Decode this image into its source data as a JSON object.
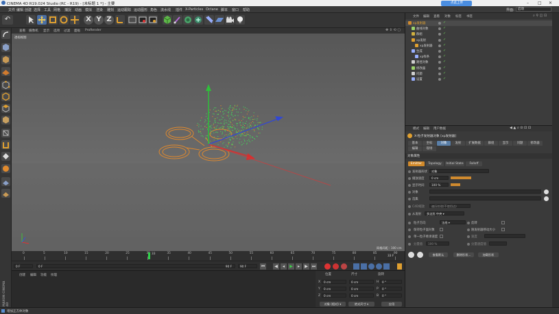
{
  "window": {
    "title": "CINEMA 4D R19.024 Studio (RC - R19) - [未标题 1 *] - 主要",
    "upload_button": "点此上传"
  },
  "menu": [
    "文件",
    "编辑",
    "创建",
    "选择",
    "工具",
    "网格",
    "捕捉",
    "动画",
    "模拟",
    "渲染",
    "雕刻",
    "运动跟踪",
    "运动图形",
    "角色",
    "流水线",
    "插件",
    "X-Particles",
    "Octane",
    "脚本",
    "窗口",
    "帮助"
  ],
  "layout": {
    "label": "界面:",
    "value": "启动"
  },
  "viewport": {
    "menu": [
      "查看",
      "摄像机",
      "显示",
      "选项",
      "过滤",
      "面板",
      "ProRender"
    ],
    "label": "透视视图",
    "grid_spacing": "网格间距 : 100 cm"
  },
  "timeline": {
    "ticks": [
      "0",
      "5",
      "10",
      "15",
      "20",
      "25",
      "30",
      "35",
      "40",
      "45",
      "50",
      "55",
      "60",
      "65",
      "70",
      "75",
      "80",
      "85",
      "90"
    ],
    "current_frame": "33 F",
    "playhead_label": "33",
    "end_label": "90 F",
    "start_field": "0 F",
    "range_start": "0 F",
    "range_end": "90 F",
    "range_end2": "90 F"
  },
  "material_manager": {
    "tabs": [
      "创建",
      "编辑",
      "功能",
      "纹理"
    ]
  },
  "coordinates": {
    "headers": [
      "位置",
      "尺寸",
      "旋转"
    ],
    "rows": [
      {
        "axis": "X",
        "pos": "0 cm",
        "size": "0 cm",
        "rot_label": "H",
        "rot": "0 °"
      },
      {
        "axis": "Y",
        "pos": "0 cm",
        "size": "0 cm",
        "rot_label": "P",
        "rot": "0 °"
      },
      {
        "axis": "Z",
        "pos": "0 cm",
        "size": "0 cm",
        "rot_label": "B",
        "rot": "0 °"
      }
    ],
    "mode1": "对象 (相对)",
    "mode2": "绝对尺寸",
    "apply": "应用"
  },
  "object_manager": {
    "menu": [
      "文件",
      "编辑",
      "查看",
      "对象",
      "标签",
      "书签"
    ],
    "items": [
      {
        "name": "xp发射器",
        "indent": 0,
        "color": "#d08a2e"
      },
      {
        "name": "曲线对象",
        "indent": 1,
        "color": "#9bd36a"
      },
      {
        "name": "群组",
        "indent": 1,
        "color": "#d0b040"
      },
      {
        "name": "xp发射",
        "indent": 1,
        "color": "#e0a030"
      },
      {
        "name": "xp发射器",
        "indent": 2,
        "color": "#e0a030"
      },
      {
        "name": "生成",
        "indent": 1,
        "color": "#9ab0ff"
      },
      {
        "name": "xp样条",
        "indent": 2,
        "color": "#9ab0ff"
      },
      {
        "name": "路径对象",
        "indent": 1,
        "color": "#cfcfcf"
      },
      {
        "name": "修改器",
        "indent": 1,
        "color": "#9bd36a"
      },
      {
        "name": "问题",
        "indent": 1,
        "color": "#cfcfcf"
      },
      {
        "name": "设置",
        "indent": 1,
        "color": "#9ab0ff"
      }
    ]
  },
  "attributes": {
    "menu": [
      "模式",
      "编辑",
      "用户数据"
    ],
    "object_title": "X-粒子发射器对象 [xp发射器]",
    "tabs_row1": [
      "基本",
      "坐标",
      "对象",
      "发射",
      "扩展数据",
      "群组",
      "显示",
      "问题",
      "修改器"
    ],
    "tabs_row2": [
      "编辑",
      "现场"
    ],
    "section": "对象属性",
    "subtabs": [
      "Emitter",
      "Topology",
      "Initial State",
      "Falloff"
    ],
    "fields": [
      {
        "label": "发射器形状",
        "value": "对象"
      },
      {
        "label": "播放速度",
        "value": "0 cm"
      },
      {
        "label": "显示时间",
        "value": "100 %"
      },
      {
        "label": "对象",
        "value": ""
      },
      {
        "label": "选集",
        "value": ""
      },
      {
        "label": "C4D缩放",
        "value": "遍历纹理(不使用边)"
      },
      {
        "label": "从发射",
        "value": "多边形 中央"
      }
    ],
    "options": [
      {
        "left_label": "粒子方向",
        "left_value": "法线",
        "right_label": "反转"
      },
      {
        "left_label": "保持粒子面对象",
        "left_value": "",
        "right_label": "随发射器移动大小"
      },
      {
        "left_label": "单一粒子继承速度",
        "left_value": "",
        "right_label": "速度"
      },
      {
        "left_label": "分量值",
        "left_value": "100 %",
        "right_label": "分量速度值"
      }
    ],
    "buttons": [
      "查看默认",
      "删除形状...",
      "加载形状"
    ]
  },
  "status": "增加正方体对象"
}
